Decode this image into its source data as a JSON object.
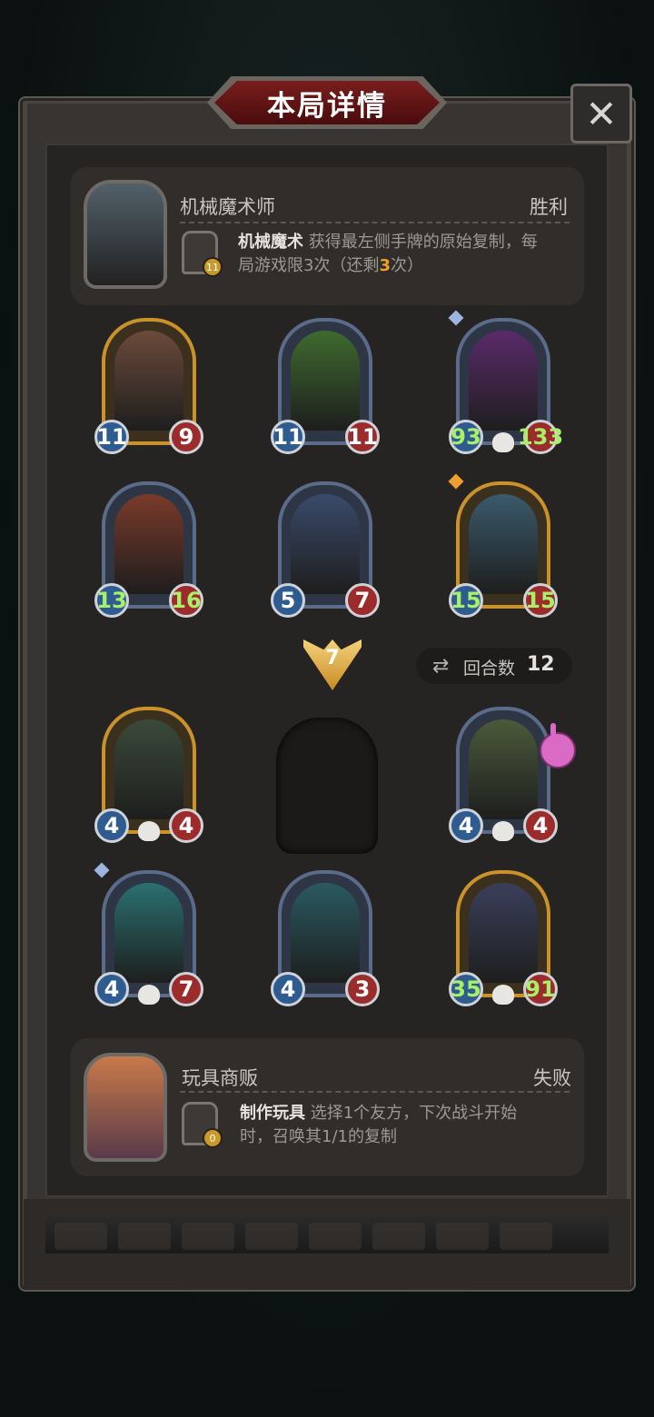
{
  "title": "本局详情",
  "close_label": "✕",
  "winner": {
    "hero_name": "机械魔术师",
    "result": "胜利",
    "skill_level": "11",
    "skill_name": "机械魔术",
    "skill_desc_1": "获得最左侧手牌的原始复制，每",
    "skill_desc_2a": "局游戏限3次（还剩",
    "skill_desc_2b": "3",
    "skill_desc_2c": "次）"
  },
  "loser": {
    "hero_name": "玩具商贩",
    "result": "失败",
    "skill_level": "0",
    "skill_name": "制作玩具",
    "skill_desc_1": "选择1个友方，下次战斗开始",
    "skill_desc_2": "时，召唤其1/1的复制"
  },
  "damage_arrow": "7",
  "rounds": {
    "label": "回合数",
    "value": "12",
    "icon": "swap-icon"
  },
  "winner_board": [
    {
      "atk": "11",
      "hp": "9",
      "frame": "gold",
      "art": "#6b4a3a"
    },
    {
      "atk": "11",
      "hp": "11",
      "frame": "blue",
      "art": "#3f6a2e"
    },
    {
      "atk": "93",
      "hp": "133",
      "frame": "blue",
      "art": "#5a2a6a"
    },
    {
      "atk": "13",
      "hp": "16",
      "frame": "blue",
      "art": "#7a3a2a"
    },
    {
      "atk": "5",
      "hp": "7",
      "frame": "blue",
      "art": "#3a4a6a"
    },
    {
      "atk": "15",
      "hp": "15",
      "frame": "gold",
      "art": "#3a5a6a"
    }
  ],
  "loser_board": [
    {
      "atk": "4",
      "hp": "4",
      "frame": "gold",
      "art": "#3a4a3a"
    },
    {
      "atk": "4",
      "hp": "4",
      "frame": "blue",
      "art": "#4a5a3a"
    },
    {
      "atk": "4",
      "hp": "7",
      "frame": "blue",
      "art": "#2a7070"
    },
    {
      "atk": "4",
      "hp": "3",
      "frame": "blue",
      "art": "#2a5a60"
    },
    {
      "atk": "35",
      "hp": "91",
      "frame": "gold",
      "art": "#3a3f5a"
    }
  ]
}
